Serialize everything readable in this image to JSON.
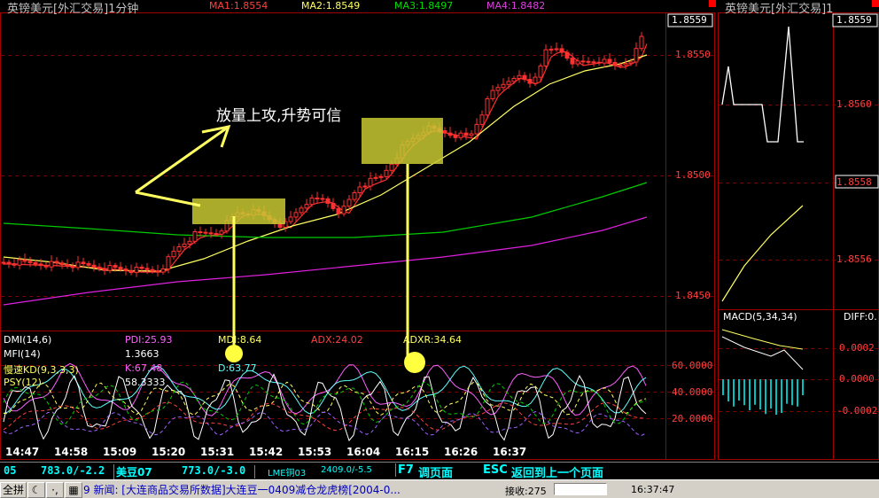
{
  "main_chart": {
    "title": "英镑美元[外汇交易]1分钟",
    "ma1": "MA1:1.8554",
    "ma2": "MA2:1.8549",
    "ma3": "MA3:1.8497",
    "ma4": "MA4:1.8482",
    "current_price": "1.8559",
    "annotation": "放量上攻,升势可信",
    "price_labels": [
      "1.8550",
      "1.8500",
      "1.8450"
    ],
    "time_labels": [
      "14:47",
      "14:58",
      "15:09",
      "15:20",
      "15:31",
      "15:42",
      "15:53",
      "16:04",
      "16:15",
      "16:26",
      "16:37"
    ]
  },
  "indicators": {
    "dmi": "DMI(14,6)",
    "pdi": "PDI:25.93",
    "mdi": "MDI:8.64",
    "adx": "ADX:24.02",
    "adxr": "ADXR:34.64",
    "mfi_label": "MFI(14)",
    "mfi_value": "1.3663",
    "kd_label": "慢速KD(9,3,3,3)",
    "k_value": "K:67.48",
    "d_value": "D:63.77",
    "psy_label": "PSY(12)",
    "psy_value": "58.3333",
    "levels": [
      "60.0000",
      "40.0000",
      "20.0000"
    ]
  },
  "right_panel": {
    "title": "英镑美元[外汇交易]1(",
    "current_price": "1.8559",
    "price_labels": [
      "1.8560",
      "1.8558",
      "1.8556"
    ],
    "macd_label": "MACD(5,34,34)",
    "diff_label": "DIFF:0.",
    "macd_levels": [
      "0.0002",
      "0.0000",
      "-0.0002"
    ],
    "box_label": "1.8"
  },
  "bottom_bar": {
    "item1_code": "05",
    "item1_value": "783.0/-2.2",
    "item2_name": "美豆07",
    "item2_value": "773.0/-3.0",
    "item3_name": "LME铜03",
    "item3_value": "2409.0/-5.5",
    "f7_key": "F7",
    "f7_label": "调页面",
    "esc_key": "ESC",
    "esc_label": "返回到上一个页面"
  },
  "status_bar": {
    "full_button": "全拼",
    "news": "9 新闻: [大连商品交易所数据]大连豆一0409减仓龙虎榜[2004-0...",
    "receive_label": "接收:275",
    "time": "16:37:47"
  },
  "colors": {
    "candle": "#ff3030",
    "ma1": "#ff3030",
    "ma2": "#ffff60",
    "ma3": "#00cc00",
    "ma4": "#e020e0",
    "annotation": "#ffff60"
  }
}
